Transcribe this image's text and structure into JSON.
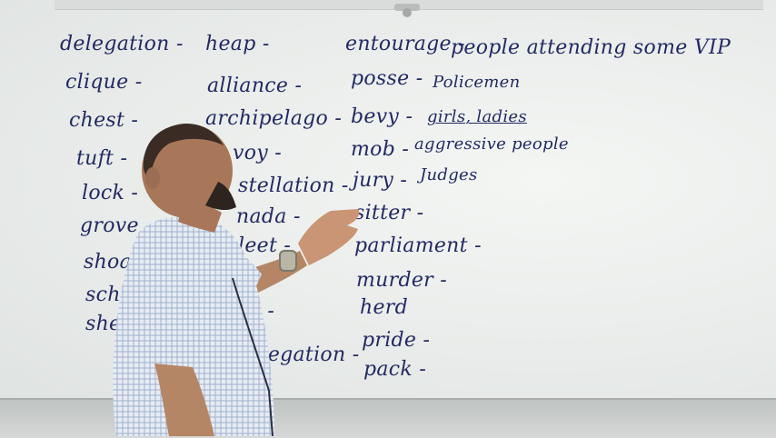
{
  "board": {
    "column1": [
      "delegation -",
      "clique -",
      "chest -",
      "tuft -",
      "lock -",
      "grove -",
      "shoal",
      "sch",
      "she"
    ],
    "column2": [
      "heap -",
      "alliance -",
      "archipelago -",
      "voy -",
      "stellation -",
      "nada -",
      "leet -",
      "t -",
      "regation -"
    ],
    "column3": [
      "entourage -",
      "posse -",
      "bevy -",
      "mob -",
      "jury -",
      "sitter -",
      "parliament -",
      "murder -",
      "herd",
      "pride -",
      "pack -"
    ],
    "annotations": {
      "entourage": "people attending some VIP",
      "posse": "Policemen",
      "bevy": "girls, ladies",
      "mob": "aggressive people",
      "jury": "Judges"
    }
  },
  "colors": {
    "board": "#eef0ee",
    "ink": "#232a63",
    "frame": "#a9adab"
  }
}
